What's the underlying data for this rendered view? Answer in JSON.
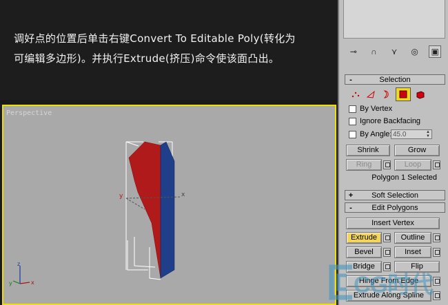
{
  "caption": {
    "line1": "调好点的位置后单击右键Convert To Editable Poly(转化为",
    "line2": "可编辑多边形)。并执行Extrude(挤压)命令使该面凸出。"
  },
  "viewport": {
    "label": "Perspective",
    "gizmo": {
      "x": "x",
      "y": "y"
    },
    "axis_tripod": {
      "x": "x",
      "y": "y",
      "z": "z"
    }
  },
  "panel": {
    "tabs": [
      {
        "icon": "create-pin-icon",
        "glyph": "⊸"
      },
      {
        "icon": "modify-icon",
        "glyph": "∩"
      },
      {
        "icon": "hierarchy-icon",
        "glyph": "⋎"
      },
      {
        "icon": "motion-icon",
        "glyph": "◎"
      },
      {
        "icon": "display-icon",
        "glyph": "▣"
      }
    ],
    "selection": {
      "title": "Selection",
      "sign": "-",
      "by_vertex": "By Vertex",
      "ignore_backfacing": "Ignore Backfacing",
      "by_angle": "By Angle:",
      "angle_value": "45.0",
      "shrink": "Shrink",
      "grow": "Grow",
      "ring": "Ring",
      "loop": "Loop",
      "status": "Polygon 1 Selected"
    },
    "soft_selection": {
      "title": "Soft Selection",
      "sign": "+"
    },
    "edit_polygons": {
      "title": "Edit Polygons",
      "sign": "-",
      "insert_vertex": "Insert Vertex",
      "extrude": "Extrude",
      "outline": "Outline",
      "bevel": "Bevel",
      "inset": "Inset",
      "bridge": "Bridge",
      "flip": "Flip",
      "hinge": "Hinge From Edge",
      "extrude_spline": "Extrude Along Spline"
    }
  },
  "watermark": {
    "text": "CG时代"
  },
  "colors": {
    "active_button": "#f2d55a",
    "viewport_border": "#f0e000",
    "red_face": "#b01a1a",
    "blue_face": "#1f3f8a"
  }
}
